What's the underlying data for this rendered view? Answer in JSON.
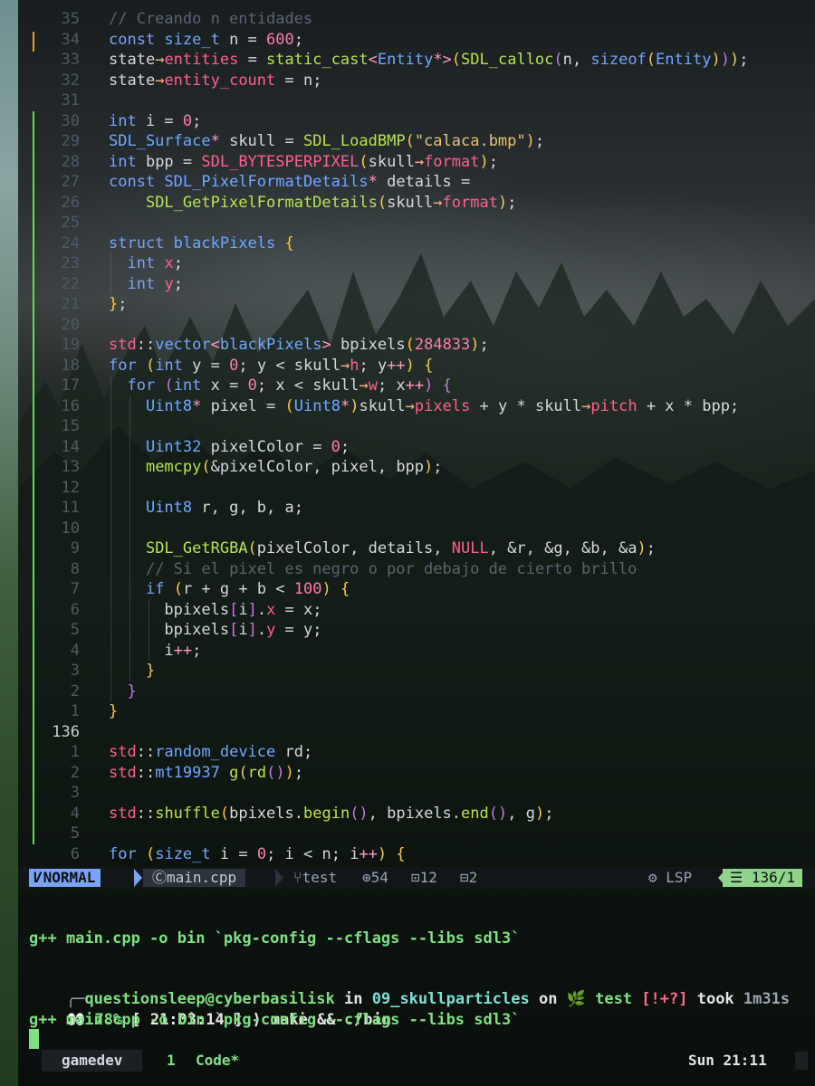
{
  "editor": {
    "lines": [
      {
        "n": "35",
        "tokens": [
          [
            "c",
            "// Creando n entidades"
          ]
        ],
        "indent": 0
      },
      {
        "n": "34",
        "tokens": [
          [
            "k",
            "const "
          ],
          [
            "t",
            "size_t"
          ],
          [
            "p",
            " n = "
          ],
          [
            "n",
            "600"
          ],
          [
            "p",
            ";"
          ]
        ],
        "indent": 0
      },
      {
        "n": "33",
        "tokens": [
          [
            "p",
            "state"
          ],
          [
            "u",
            "→"
          ],
          [
            "m",
            "entities"
          ],
          [
            "p",
            " = "
          ],
          [
            "f",
            "static_cast"
          ],
          [
            "o",
            "<"
          ],
          [
            "t",
            "Entity"
          ],
          [
            "o",
            "*>"
          ],
          [
            "y",
            "("
          ],
          [
            "f",
            "SDL_calloc"
          ],
          [
            "v",
            "("
          ],
          [
            "p",
            "n, "
          ],
          [
            "k",
            "sizeof"
          ],
          [
            "y",
            "("
          ],
          [
            "t",
            "Entity"
          ],
          [
            "y",
            ")"
          ],
          [
            "v",
            ")"
          ],
          [
            "y",
            ")"
          ],
          [
            "p",
            ";"
          ]
        ],
        "indent": 0
      },
      {
        "n": "32",
        "tokens": [
          [
            "p",
            "state"
          ],
          [
            "u",
            "→"
          ],
          [
            "m",
            "entity_count"
          ],
          [
            "p",
            " = n;"
          ]
        ],
        "indent": 0
      },
      {
        "n": "31",
        "tokens": [],
        "indent": 0
      },
      {
        "n": "30",
        "tokens": [
          [
            "k",
            "int"
          ],
          [
            "p",
            " i = "
          ],
          [
            "n",
            "0"
          ],
          [
            "p",
            ";"
          ]
        ],
        "indent": 0
      },
      {
        "n": "29",
        "tokens": [
          [
            "t",
            "SDL_Surface"
          ],
          [
            "o",
            "*"
          ],
          [
            "p",
            " skull = "
          ],
          [
            "f",
            "SDL_LoadBMP"
          ],
          [
            "y",
            "("
          ],
          [
            "s",
            "\"calaca.bmp\""
          ],
          [
            "y",
            ")"
          ],
          [
            "p",
            ";"
          ]
        ],
        "indent": 0
      },
      {
        "n": "28",
        "tokens": [
          [
            "k",
            "int"
          ],
          [
            "p",
            " bpp = "
          ],
          [
            "m",
            "SDL_BYTESPERPIXEL"
          ],
          [
            "y",
            "("
          ],
          [
            "p",
            "skull"
          ],
          [
            "u",
            "→"
          ],
          [
            "m",
            "format"
          ],
          [
            "y",
            ")"
          ],
          [
            "p",
            ";"
          ]
        ],
        "indent": 0
      },
      {
        "n": "27",
        "tokens": [
          [
            "k",
            "const "
          ],
          [
            "t",
            "SDL_PixelFormatDetails"
          ],
          [
            "o",
            "*"
          ],
          [
            "p",
            " details ="
          ]
        ],
        "indent": 0
      },
      {
        "n": "26",
        "tokens": [
          [
            "p",
            "    "
          ],
          [
            "f",
            "SDL_GetPixelFormatDetails"
          ],
          [
            "y",
            "("
          ],
          [
            "p",
            "skull"
          ],
          [
            "u",
            "→"
          ],
          [
            "m",
            "format"
          ],
          [
            "y",
            ")"
          ],
          [
            "p",
            ";"
          ]
        ],
        "indent": 0
      },
      {
        "n": "25",
        "tokens": [],
        "indent": 0
      },
      {
        "n": "24",
        "tokens": [
          [
            "k",
            "struct "
          ],
          [
            "t",
            "blackPixels"
          ],
          [
            "p",
            " "
          ],
          [
            "y",
            "{"
          ]
        ],
        "indent": 0
      },
      {
        "n": "23",
        "tokens": [
          [
            "p",
            "  "
          ],
          [
            "k",
            "int"
          ],
          [
            "p",
            " "
          ],
          [
            "m",
            "x"
          ],
          [
            "p",
            ";"
          ]
        ],
        "indent": 1
      },
      {
        "n": "22",
        "tokens": [
          [
            "p",
            "  "
          ],
          [
            "k",
            "int"
          ],
          [
            "p",
            " "
          ],
          [
            "m",
            "y"
          ],
          [
            "p",
            ";"
          ]
        ],
        "indent": 1
      },
      {
        "n": "21",
        "tokens": [
          [
            "y",
            "}"
          ],
          [
            "p",
            ";"
          ]
        ],
        "indent": 0
      },
      {
        "n": "20",
        "tokens": [],
        "indent": 0
      },
      {
        "n": "19",
        "tokens": [
          [
            "m",
            "std"
          ],
          [
            "p",
            "::"
          ],
          [
            "t",
            "vector"
          ],
          [
            "o",
            "<"
          ],
          [
            "t",
            "blackPixels"
          ],
          [
            "o",
            ">"
          ],
          [
            "p",
            " bpixels"
          ],
          [
            "y",
            "("
          ],
          [
            "n",
            "284833"
          ],
          [
            "y",
            ")"
          ],
          [
            "p",
            ";"
          ]
        ],
        "indent": 0
      },
      {
        "n": "18",
        "tokens": [
          [
            "k",
            "for"
          ],
          [
            "p",
            " "
          ],
          [
            "y",
            "("
          ],
          [
            "k",
            "int"
          ],
          [
            "p",
            " y = "
          ],
          [
            "n",
            "0"
          ],
          [
            "p",
            "; y < skull"
          ],
          [
            "u",
            "→"
          ],
          [
            "m",
            "h"
          ],
          [
            "p",
            "; y"
          ],
          [
            "o",
            "++"
          ],
          [
            "y",
            ")"
          ],
          [
            "p",
            " "
          ],
          [
            "y",
            "{"
          ]
        ],
        "indent": 0
      },
      {
        "n": "17",
        "tokens": [
          [
            "p",
            "  "
          ],
          [
            "k",
            "for"
          ],
          [
            "p",
            " "
          ],
          [
            "v",
            "("
          ],
          [
            "k",
            "int"
          ],
          [
            "p",
            " x = "
          ],
          [
            "n",
            "0"
          ],
          [
            "p",
            "; x < skull"
          ],
          [
            "u",
            "→"
          ],
          [
            "m",
            "w"
          ],
          [
            "p",
            "; x"
          ],
          [
            "o",
            "++"
          ],
          [
            "v",
            ")"
          ],
          [
            "p",
            " "
          ],
          [
            "v",
            "{"
          ]
        ],
        "indent": 1
      },
      {
        "n": "16",
        "tokens": [
          [
            "p",
            "    "
          ],
          [
            "t",
            "Uint8"
          ],
          [
            "o",
            "*"
          ],
          [
            "p",
            " pixel = "
          ],
          [
            "y",
            "("
          ],
          [
            "t",
            "Uint8"
          ],
          [
            "o",
            "*"
          ],
          [
            "y",
            ")"
          ],
          [
            "p",
            "skull"
          ],
          [
            "u",
            "→"
          ],
          [
            "m",
            "pixels"
          ],
          [
            "p",
            " + y * skull"
          ],
          [
            "u",
            "→"
          ],
          [
            "m",
            "pitch"
          ],
          [
            "p",
            " + x * bpp;"
          ]
        ],
        "indent": 2
      },
      {
        "n": "15",
        "tokens": [],
        "indent": 2
      },
      {
        "n": "14",
        "tokens": [
          [
            "p",
            "    "
          ],
          [
            "t",
            "Uint32"
          ],
          [
            "p",
            " pixelColor = "
          ],
          [
            "n",
            "0"
          ],
          [
            "p",
            ";"
          ]
        ],
        "indent": 2
      },
      {
        "n": "13",
        "tokens": [
          [
            "p",
            "    "
          ],
          [
            "f",
            "memcpy"
          ],
          [
            "y",
            "("
          ],
          [
            "p",
            "&pixelColor, pixel, bpp"
          ],
          [
            "y",
            ")"
          ],
          [
            "p",
            ";"
          ]
        ],
        "indent": 2
      },
      {
        "n": "12",
        "tokens": [],
        "indent": 2
      },
      {
        "n": "11",
        "tokens": [
          [
            "p",
            "    "
          ],
          [
            "t",
            "Uint8"
          ],
          [
            "p",
            " r, g, b, a;"
          ]
        ],
        "indent": 2
      },
      {
        "n": "10",
        "tokens": [],
        "indent": 2
      },
      {
        "n": "9",
        "tokens": [
          [
            "p",
            "    "
          ],
          [
            "f",
            "SDL_GetRGBA"
          ],
          [
            "y",
            "("
          ],
          [
            "p",
            "pixelColor, details, "
          ],
          [
            "m",
            "NULL"
          ],
          [
            "p",
            ", &r, &g, &b, &a"
          ],
          [
            "y",
            ")"
          ],
          [
            "p",
            ";"
          ]
        ],
        "indent": 2
      },
      {
        "n": "8",
        "tokens": [
          [
            "p",
            "    "
          ],
          [
            "c",
            "// Si el pixel es negro o por debajo de cierto brillo"
          ]
        ],
        "indent": 2
      },
      {
        "n": "7",
        "tokens": [
          [
            "p",
            "    "
          ],
          [
            "k",
            "if"
          ],
          [
            "p",
            " "
          ],
          [
            "y",
            "("
          ],
          [
            "p",
            "r + g + b < "
          ],
          [
            "n",
            "100"
          ],
          [
            "y",
            ")"
          ],
          [
            "p",
            " "
          ],
          [
            "y",
            "{"
          ]
        ],
        "indent": 2
      },
      {
        "n": "6",
        "tokens": [
          [
            "p",
            "      bpixels"
          ],
          [
            "v",
            "["
          ],
          [
            "p",
            "i"
          ],
          [
            "v",
            "]"
          ],
          [
            "p",
            "."
          ],
          [
            "m",
            "x"
          ],
          [
            "p",
            " = x;"
          ]
        ],
        "indent": 3
      },
      {
        "n": "5",
        "tokens": [
          [
            "p",
            "      bpixels"
          ],
          [
            "v",
            "["
          ],
          [
            "p",
            "i"
          ],
          [
            "v",
            "]"
          ],
          [
            "p",
            "."
          ],
          [
            "m",
            "y"
          ],
          [
            "p",
            " = y;"
          ]
        ],
        "indent": 3
      },
      {
        "n": "4",
        "tokens": [
          [
            "p",
            "      i"
          ],
          [
            "o",
            "++"
          ],
          [
            "p",
            ";"
          ]
        ],
        "indent": 3
      },
      {
        "n": "3",
        "tokens": [
          [
            "p",
            "    "
          ],
          [
            "y",
            "}"
          ]
        ],
        "indent": 2
      },
      {
        "n": "2",
        "tokens": [
          [
            "p",
            "  "
          ],
          [
            "v",
            "}"
          ]
        ],
        "indent": 1
      },
      {
        "n": "1",
        "tokens": [
          [
            "y",
            "}"
          ]
        ],
        "indent": 0
      },
      {
        "n": "136",
        "tokens": [],
        "indent": 0,
        "current": true
      },
      {
        "n": "1",
        "tokens": [
          [
            "m",
            "std"
          ],
          [
            "p",
            "::"
          ],
          [
            "t",
            "random_device"
          ],
          [
            "p",
            " rd;"
          ]
        ],
        "indent": 0
      },
      {
        "n": "2",
        "tokens": [
          [
            "m",
            "std"
          ],
          [
            "p",
            "::"
          ],
          [
            "t",
            "mt19937"
          ],
          [
            "p",
            " "
          ],
          [
            "f",
            "g"
          ],
          [
            "y",
            "("
          ],
          [
            "f",
            "rd"
          ],
          [
            "v",
            "()"
          ],
          [
            "y",
            ")"
          ],
          [
            "p",
            ";"
          ]
        ],
        "indent": 0
      },
      {
        "n": "3",
        "tokens": [],
        "indent": 0
      },
      {
        "n": "4",
        "tokens": [
          [
            "m",
            "std"
          ],
          [
            "p",
            "::"
          ],
          [
            "f",
            "shuffle"
          ],
          [
            "y",
            "("
          ],
          [
            "p",
            "bpixels."
          ],
          [
            "f",
            "begin"
          ],
          [
            "v",
            "()"
          ],
          [
            "p",
            ", bpixels."
          ],
          [
            "f",
            "end"
          ],
          [
            "v",
            "()"
          ],
          [
            "p",
            ", g"
          ],
          [
            "y",
            ")"
          ],
          [
            "p",
            ";"
          ]
        ],
        "indent": 0
      },
      {
        "n": "5",
        "tokens": [],
        "indent": 0
      },
      {
        "n": "6",
        "tokens": [
          [
            "k",
            "for"
          ],
          [
            "p",
            " "
          ],
          [
            "y",
            "("
          ],
          [
            "t",
            "size_t"
          ],
          [
            "p",
            " i = "
          ],
          [
            "n",
            "0"
          ],
          [
            "p",
            "; i < n; i"
          ],
          [
            "o",
            "++"
          ],
          [
            "y",
            ")"
          ],
          [
            "p",
            " "
          ],
          [
            "y",
            "{"
          ]
        ],
        "indent": 0
      }
    ]
  },
  "statusline": {
    "mode": "NORMAL",
    "file": "main.cpp",
    "branch": "test",
    "added": "54",
    "modified": "12",
    "removed": "2",
    "lsp": "LSP",
    "position": "136/1",
    "colors": {
      "mode_bg": "#7aa2f7",
      "position_bg": "#8fd48a"
    }
  },
  "terminal": {
    "line1": "g++ main.cpp -o bin `pkg-config --cflags --libs sdl3`",
    "prompt_user": "questionsleep@cyberbasilisk",
    "prompt_in": " in ",
    "prompt_dir": "09_skullparticles",
    "prompt_on": " on ",
    "prompt_branch": "test",
    "prompt_status": "[!+?]",
    "prompt_took": " took ",
    "prompt_duration": "1m31s",
    "eyes": "👀",
    "battery": "78%",
    "clock_box": "[ 21:03:14 ]",
    "arrow": "⟩",
    "command": "make && ./bin",
    "line4": "g++ main.cpp -o bin `pkg-config --cflags --libs sdl3`"
  },
  "tmux": {
    "session": "gamedev",
    "window_index": "1",
    "window_name": "Code*",
    "clock": "Sun 21:11"
  }
}
